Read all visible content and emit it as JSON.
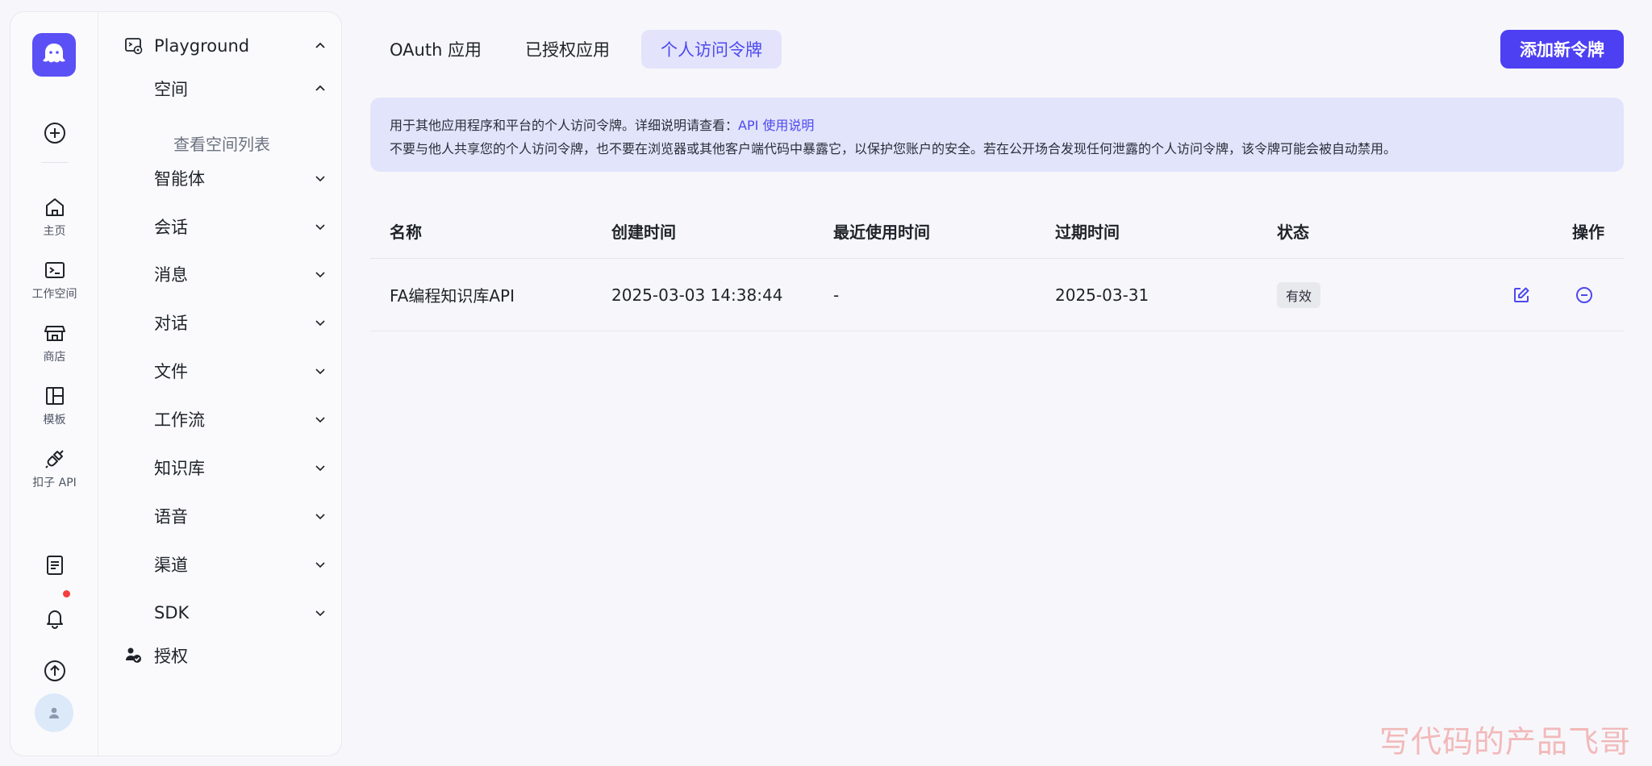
{
  "rail": {
    "items": [
      {
        "label": "主页",
        "icon": "home-icon"
      },
      {
        "label": "工作空间",
        "icon": "terminal-icon"
      },
      {
        "label": "商店",
        "icon": "store-icon"
      },
      {
        "label": "模板",
        "icon": "layout-icon"
      },
      {
        "label": "扣子 API",
        "icon": "plug-icon"
      }
    ]
  },
  "tree": {
    "root": "Playground",
    "space": "空间",
    "space_sub": "查看空间列表",
    "items": [
      "智能体",
      "会话",
      "消息",
      "对话",
      "文件",
      "工作流",
      "知识库",
      "语音",
      "渠道",
      "SDK"
    ],
    "auth": "授权"
  },
  "tabs": [
    "OAuth 应用",
    "已授权应用",
    "个人访问令牌"
  ],
  "active_tab": "个人访问令牌",
  "add_button": "添加新令牌",
  "notice": {
    "line1_prefix": "用于其他应用程序和平台的个人访问令牌。详细说明请查看：",
    "link": "API 使用说明",
    "line2": "不要与他人共享您的个人访问令牌，也不要在浏览器或其他客户端代码中暴露它，以保护您账户的安全。若在公开场合发现任何泄露的个人访问令牌，该令牌可能会被自动禁用。"
  },
  "table": {
    "headers": [
      "名称",
      "创建时间",
      "最近使用时间",
      "过期时间",
      "状态",
      "操作"
    ],
    "rows": [
      {
        "name": "FA编程知识库API",
        "created": "2025-03-03 14:38:44",
        "last_used": "-",
        "expires": "2025-03-31",
        "status": "有效"
      }
    ]
  },
  "watermark": "写代码的产品飞哥",
  "colors": {
    "accent": "#4d3ff2",
    "active_tab_bg": "#e3e3fb",
    "notice_bg": "#e2e4fb",
    "badge_red": "#f53f3f"
  }
}
